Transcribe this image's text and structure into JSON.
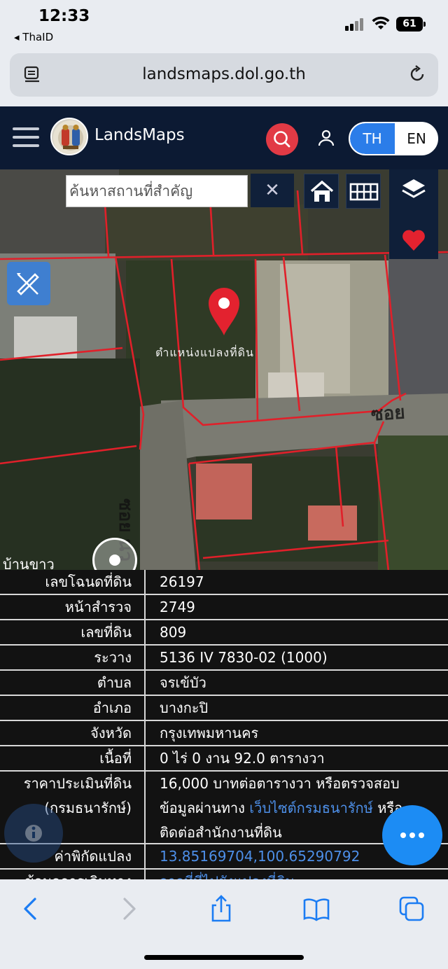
{
  "status": {
    "time": "12:33",
    "back_app": "◂ ThaID",
    "battery": "61"
  },
  "browser": {
    "url": "landsmaps.dol.go.th"
  },
  "header": {
    "brand": "LandsMaps",
    "lang_th": "TH",
    "lang_en": "EN",
    "active_lang": "TH"
  },
  "map": {
    "search_placeholder": "ค้นหาสถานที่สำคัญ",
    "clear": "✕",
    "parcel_label": "ตำแหน่งแปลงที่ดิน",
    "road_label_1": "ซอย",
    "road_label_2": "ซอย นว",
    "place_label": "บ้านขาว"
  },
  "parcel": {
    "rows": [
      {
        "key": "เลขโฉนดที่ดิน",
        "value": "26197"
      },
      {
        "key": "หน้าสำรวจ",
        "value": "2749"
      },
      {
        "key": "เลขที่ดิน",
        "value": "809"
      },
      {
        "key": "ระวาง",
        "value": "5136 IV 7830-02 (1000)"
      },
      {
        "key": "ตำบล",
        "value": "จรเข้บัว"
      },
      {
        "key": "อำเภอ",
        "value": "บางกะปิ"
      },
      {
        "key": "จังหวัด",
        "value": "กรุงเทพมหานคร"
      },
      {
        "key": "เนื้อที่",
        "value": "0 ไร่ 0 งาน 92.0 ตารางวา"
      }
    ],
    "price_key_1": "ราคาประเมินที่ดิน",
    "price_key_2": "(กรมธนารักษ์)",
    "price_line_1": "16,000 บาทต่อตารางวา หรือตรวจสอบ",
    "price_line_2_a": "ข้อมูลผ่านทาง ",
    "price_link": "เว็บไซต์กรมธนารักษ์",
    "price_line_2_b": " หรือ",
    "price_line_3": "ติดต่อสำนักงานที่ดิน",
    "coord_key": "ค่าพิกัดแปลง",
    "coord_value": "13.85169704,100.65290792",
    "travel_key": "ข้อมูลการเดินทาง",
    "travel_value": "จากที่ที่ไปยังแปลงที่ดิน"
  },
  "colors": {
    "header_bg": "#0c1a33",
    "accent_blue": "#2b7de9",
    "search_red": "#e23a45",
    "link_blue": "#4d8fe8",
    "parcel_line": "#e0202a"
  },
  "toolbar": {
    "icons": [
      "back-icon",
      "forward-icon",
      "share-icon",
      "bookmarks-icon",
      "tabs-icon"
    ]
  }
}
